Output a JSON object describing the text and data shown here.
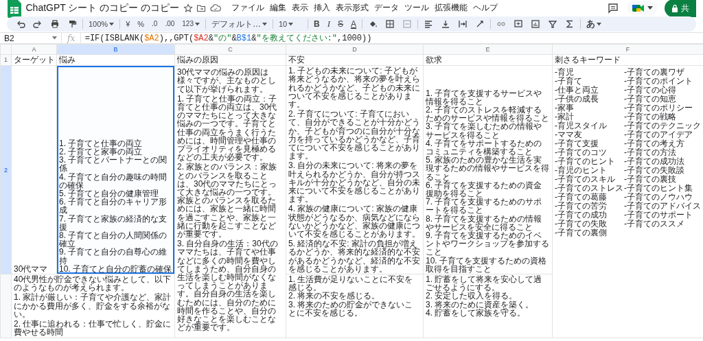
{
  "app": {
    "title": "ChatGPT シート のコピー のコピー",
    "menus": [
      "ファイル",
      "編集",
      "表示",
      "挿入",
      "表示形式",
      "データ",
      "ツール",
      "拡張機能",
      "ヘルプ"
    ],
    "share_label": "共"
  },
  "toolbar": {
    "zoom": "100%",
    "currency": "¥",
    "percent": "%",
    "dec_decrease": ".0",
    "dec_increase": ".00",
    "number_format": "123",
    "font": "デフォルト…",
    "font_size": "10",
    "bold": "B",
    "italic": "I",
    "strike": "S",
    "text_color": "A",
    "input_tool": "あ"
  },
  "formula_bar": {
    "cell_ref": "B2",
    "fx": "fx",
    "tokens": [
      {
        "kind": "plain",
        "text": "=IF(ISBLANK("
      },
      {
        "kind": "ref",
        "text": "$A2",
        "color": "#e37400"
      },
      {
        "kind": "plain",
        "text": "),,GPT("
      },
      {
        "kind": "ref",
        "text": "$A2",
        "color": "#d93025"
      },
      {
        "kind": "plain",
        "text": "&"
      },
      {
        "kind": "string",
        "text": "\"の\""
      },
      {
        "kind": "plain",
        "text": "&"
      },
      {
        "kind": "ref",
        "text": "B$1",
        "color": "#1a73e8"
      },
      {
        "kind": "plain",
        "text": "&"
      },
      {
        "kind": "string",
        "text": "\"を教えてください:\""
      },
      {
        "kind": "plain",
        "text": ",1000))"
      }
    ]
  },
  "columns": [
    {
      "letter": "A",
      "selected": false
    },
    {
      "letter": "B",
      "selected": true
    },
    {
      "letter": "C",
      "selected": false
    },
    {
      "letter": "D",
      "selected": false
    },
    {
      "letter": "E",
      "selected": false
    },
    {
      "letter": "F",
      "selected": false
    }
  ],
  "rows": [
    {
      "number": "1",
      "selected": false,
      "cells": [
        {
          "text": "ターゲット",
          "selected": false
        },
        {
          "text": "悩み",
          "selected": false
        },
        {
          "text": "悩みの原因",
          "selected": false
        },
        {
          "text": "不安",
          "selected": false
        },
        {
          "text": "欲求",
          "selected": false
        },
        {
          "text": "刺さるキーワード",
          "selected": false
        }
      ]
    },
    {
      "number": "2",
      "selected": true,
      "cells": [
        {
          "text": "30代ママ",
          "selected": false
        },
        {
          "text": "1. 子育てと仕事の両立\n2. 子育てと家事の両立\n3. 子育てとパートナーとの関係\n4. 子育てと自分の趣味の時間の確保\n5. 子育てと自分の健康管理\n6. 子育てと自分のキャリア形成\n7. 子育てと家族の経済的な支援\n8. 子育てと自分の人間関係の確立\n9. 子育てと自分の自尊心の維持\n10. 子育てと自分の貯蓄の確保",
          "selected": true
        },
        {
          "text": "30代ママの悩みの原因は様々ですが、主なものとして以下が挙げられます。\n\n1. 子育てと仕事の両立：子育てと仕事の両立は、30代のママたちにとって大きな悩みの一つです。子育てと仕事の両立をうまく行うためには、時間管理や仕事のプライオリティを見極めるなどの工夫が必要です。\n\n2. 家族とのバランス：家族とのバランスを取ることは、30代のママたちにとって大きな悩みの一つです。家族とのバランスを取るためには、家族と一緒に時間を過ごすことや、家族と一緒に行動を起こすことなどが重要です。\n\n3. 自分自身の生活：30代のママたちは、子育てや仕事などに多くの時間を費やしてしまうため、自分自身の生活を楽しむ時間がなくなってしまうことがあります。自分自身の生活を楽しむためには、自分のために時間を作ることや、自分の好きなことを楽しむことなどが重要です。",
          "selected": false
        },
        {
          "text": "1. 子どもの未来について: 子どもが将来どうなるか、将来の夢を叶えられるかどうかなど、子どもの未来について不安を感じることがあります。\n\n2. 子育てについて: 子育てにおいて、自分ができることが十分かどうか、子どもが育つのに自分が十分な力を持っているかどうかなど、子育てについて不安を感じることがあります。\n\n3. 自分の未来について: 将来の夢を叶えられるかどうか、自分が持つスキルが十分かどうかなど、自分の未来について不安を感じることがあります。\n\n4. 家族の健康について: 家族の健康状態がどうなるか、病気などにならないかどうかなど、家族の健康について不安を感じることがあります。\n\n5. 経済的な不安: 家計の負担が増えるかどうか、将来的な経済的な不安があるかどうかなど、経済的な不安を感じることがあります。",
          "selected": false
        },
        {
          "text": "1. 子育てを支援するサービスや情報を得ること\n2. 子育てのストレスを軽減するためのサービスや情報を得ること\n3. 子育てを楽しむための情報やサービスを得ること\n4. 子育てをサポートするためのコミュニティを構築すること\n5. 家族のための豊かな生活を実現するための情報やサービスを得ること\n6. 子育てを支援するための資金援助を得ること\n7. 子育てを支援するためのサポートを得ること\n8. 子育てを支援するための情報やサービスを安全に得ること\n9. 子育てを支援するためのイベントやワークショップを参加すること\n10. 子育てを支援するための資格取得を目指すこと",
          "selected": false
        },
        {
          "lines": [
            "-育児",
            "-子育て",
            "-仕事と両立",
            "-子供の成長",
            "-家事",
            "-家計",
            "-育児スタイル",
            "-ママ友",
            "-子育て支援",
            "-子育てのコツ",
            "-子育てのヒント",
            "-育児のヒント",
            "-子育てのスキル",
            "-子育てのストレス",
            "-子育ての葛藤",
            "-子育ての苦労",
            "-子育ての成功",
            "-子育ての失敗",
            "-子育ての裏側",
            "-子育ての裏ワザ",
            "-子育てのポイント",
            "-子育ての心得",
            "-子育ての知恵",
            "-子育てのポリシー",
            "-子育ての戦略",
            "-子育てのテクニック",
            "-子育てのアイデア",
            "-子育ての考え方",
            "-子育ての方法",
            "-子育ての成功法",
            "-子育ての失敗談",
            "-子育ての裏技",
            "-子育てのヒント集",
            "-子育てのノウハウ",
            "-子育てのアドバイス",
            "-子育てのサポート",
            "-子育てのススメ"
          ],
          "selected": false
        }
      ]
    },
    {
      "selected": false,
      "cells": [
        {
          "selected": false
        },
        {
          "text": "40代男性が貯金できない悩みとして、以下のようなものが考えられます。\n\n1. 家計が厳しい：子育てや介護など、家計にかかる費用が多く、貯金をする余裕がない。\n\n2. 仕事に追われる：仕事で忙しく、貯金に費やせる時間",
          "selected": false
        },
        {
          "selected": false
        },
        {
          "text": "1. 生活費が足りないことに不安を感じる。\n2. 将来の不安を感じる。\n3. 将来のための貯金ができないことに不安を感じる。",
          "selected": false
        },
        {
          "text": "1. 貯蓄をして将来を安心して過ごせるようにする。\n2. 安定した収入を得る。\n3. 将来のために資産を築く。\n4. 貯蓄をして家族を守る。",
          "selected": false
        },
        {
          "selected": false
        }
      ]
    }
  ]
}
